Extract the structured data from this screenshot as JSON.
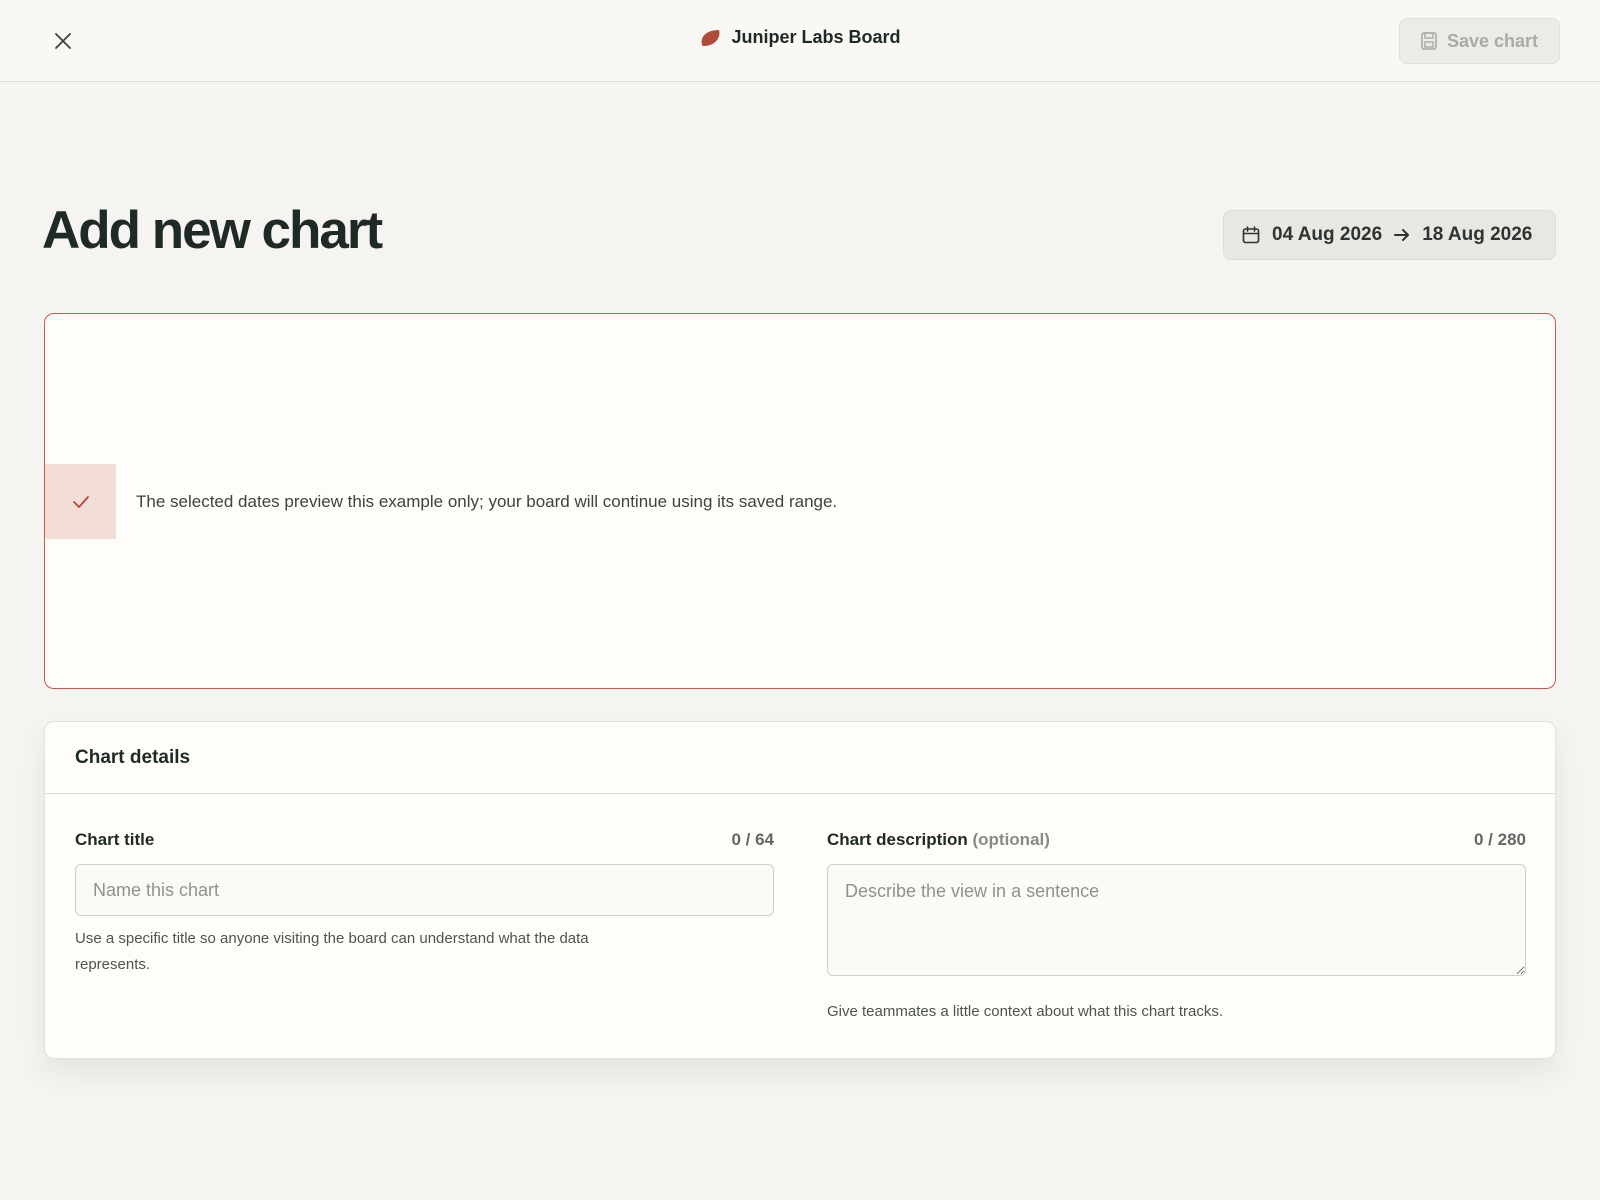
{
  "topbar": {
    "close_icon": "close-icon",
    "brand_icon": "leaf-icon",
    "brand_title": "Juniper Labs Board",
    "save_icon": "save-icon",
    "save_label": "Save chart",
    "save_enabled": false
  },
  "header": {
    "page_title": "Add new chart",
    "date_range": {
      "icon": "calendar-icon",
      "start": "04 Aug 2026",
      "end": "18 Aug 2026"
    }
  },
  "preview": {
    "notice_icon": "check-icon",
    "notice_text": "The selected dates preview this example only; your board will continue using its saved range."
  },
  "details": {
    "heading": "Chart details",
    "title_field": {
      "label": "Chart title",
      "counter": "0 / 64",
      "value": "",
      "placeholder": "Name this chart",
      "help": "Use a specific title so anyone visiting the board can understand what the data represents."
    },
    "description_field": {
      "label": "Chart description",
      "optional": "(optional)",
      "counter": "0 / 280",
      "value": "",
      "placeholder": "Describe the view in a sentence",
      "help": "Give teammates a little context about what this chart tracks."
    }
  },
  "colors": {
    "accent": "#c9584a",
    "notice_bg": "#f3ddd7",
    "page_bg": "#f5f4f1"
  }
}
